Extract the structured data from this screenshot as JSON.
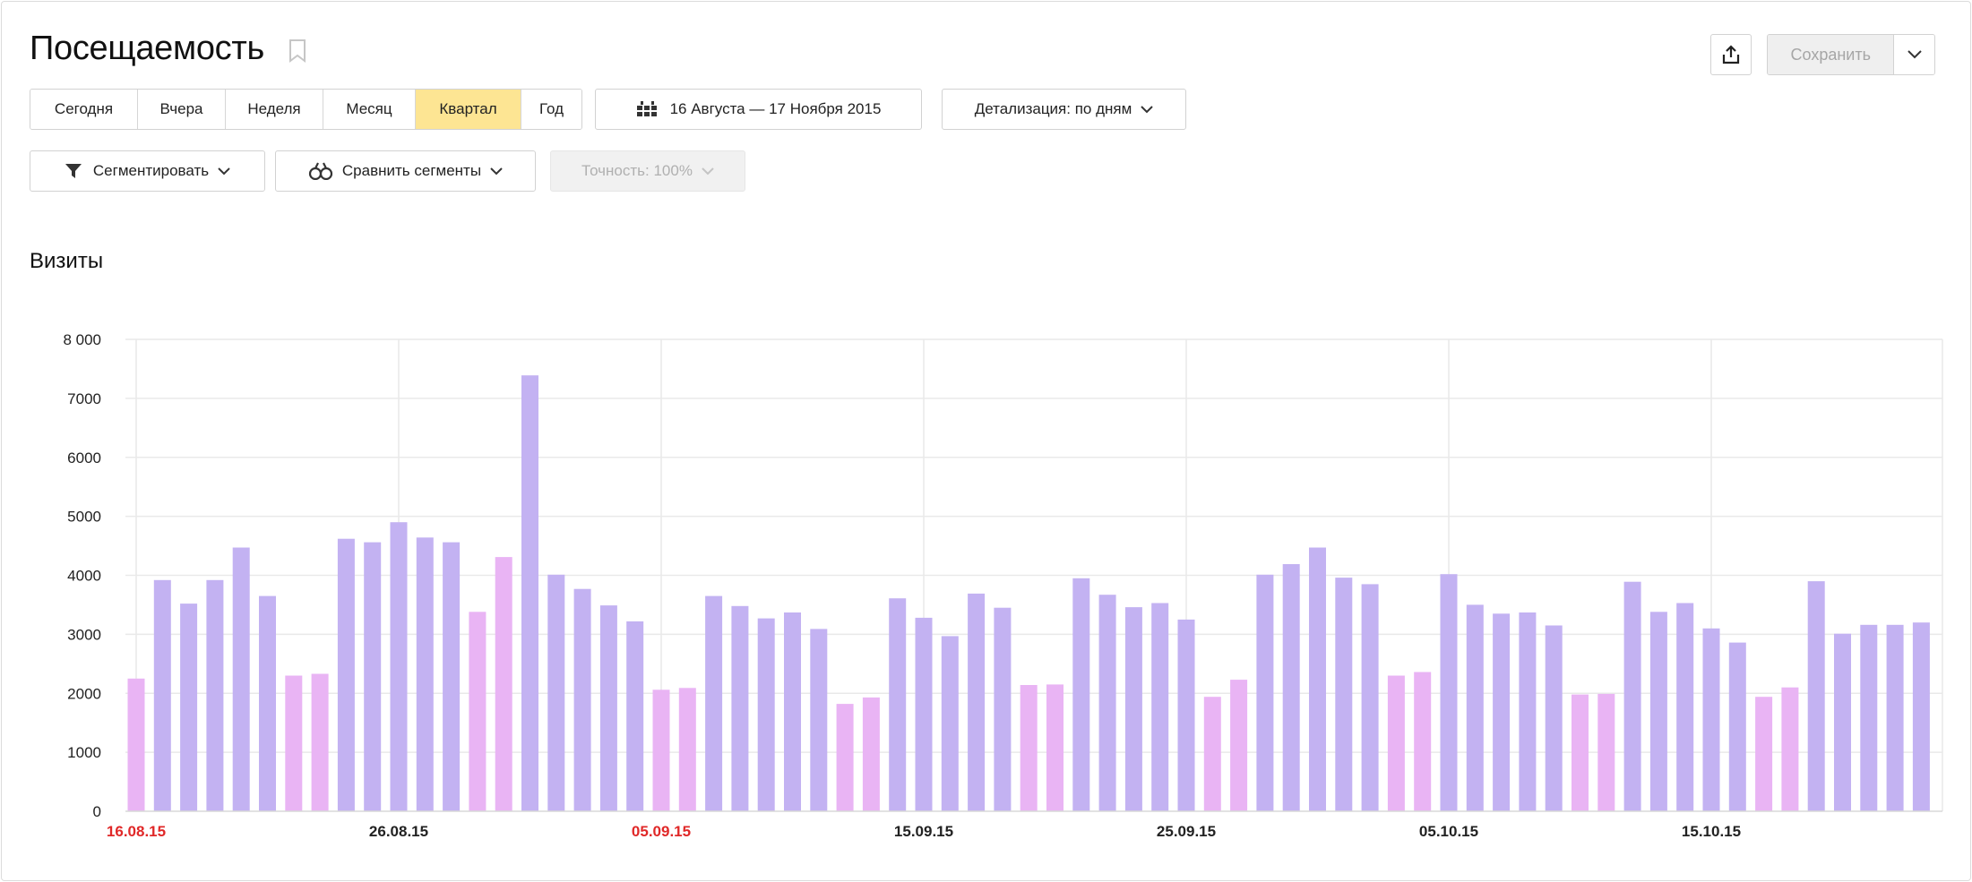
{
  "header": {
    "title": "Посещаемость",
    "share_icon": "share-icon",
    "save_label": "Сохранить",
    "bookmark_icon": "bookmark-icon"
  },
  "toolbar": {
    "periods": [
      {
        "label": "Сегодня",
        "active": false
      },
      {
        "label": "Вчера",
        "active": false
      },
      {
        "label": "Неделя",
        "active": false
      },
      {
        "label": "Месяц",
        "active": false
      },
      {
        "label": "Квартал",
        "active": true
      },
      {
        "label": "Год",
        "active": false
      }
    ],
    "date_range_label": "16 Августа — 17 Ноября 2015",
    "detail_label": "Детализация: по дням",
    "segment_label": "Сегментировать",
    "compare_label": "Сравнить сегменты",
    "accuracy_label": "Точность: 100%"
  },
  "colors": {
    "active_period": "#fde593",
    "bar_weekday": "#c3b2f2",
    "bar_weekend": "#e9b4f4",
    "weekend_tick": "#e02828",
    "grid": "#e9e9e9"
  },
  "chart_data": {
    "type": "bar",
    "title": "Визиты",
    "xlabel": "",
    "ylabel": "",
    "ylim": [
      0,
      8000
    ],
    "y_ticks": [
      0,
      1000,
      2000,
      3000,
      4000,
      5000,
      6000,
      7000,
      8000
    ],
    "y_tick_labels": [
      "0",
      "1000",
      "2000",
      "3000",
      "4000",
      "5000",
      "6000",
      "7000",
      "8 000"
    ],
    "x_tick_labels": [
      {
        "label": "16.08.15",
        "index": 0,
        "weekend": true
      },
      {
        "label": "26.08.15",
        "index": 10,
        "weekend": false
      },
      {
        "label": "05.09.15",
        "index": 20,
        "weekend": true
      },
      {
        "label": "15.09.15",
        "index": 30,
        "weekend": false
      },
      {
        "label": "25.09.15",
        "index": 40,
        "weekend": false
      },
      {
        "label": "05.10.15",
        "index": 50,
        "weekend": false
      },
      {
        "label": "15.10.15",
        "index": 60,
        "weekend": false
      }
    ],
    "grid": true,
    "series": [
      {
        "values": [
          2250,
          3920,
          3520,
          3920,
          4470,
          3650,
          2300,
          2330,
          4620,
          4560,
          4900,
          4640,
          4560,
          3380,
          4310,
          7390,
          4010,
          3770,
          3490,
          3220,
          2060,
          2090,
          3650,
          3480,
          3270,
          3370,
          3090,
          1820,
          1930,
          3610,
          3280,
          2970,
          3690,
          3450,
          2140,
          2150,
          3950,
          3670,
          3460,
          3530,
          3250,
          1940,
          2230,
          4010,
          4190,
          4470,
          3960,
          3850,
          2300,
          2360,
          4020,
          3500,
          3350,
          3370,
          3150,
          1980,
          1990,
          3890,
          3380,
          3530,
          3100,
          2860,
          1940,
          2100,
          3900,
          3010,
          3160,
          3160,
          3200
        ],
        "weekend": [
          1,
          0,
          0,
          0,
          0,
          0,
          1,
          1,
          0,
          0,
          0,
          0,
          0,
          1,
          1,
          0,
          0,
          0,
          0,
          0,
          1,
          1,
          0,
          0,
          0,
          0,
          0,
          1,
          1,
          0,
          0,
          0,
          0,
          0,
          1,
          1,
          0,
          0,
          0,
          0,
          0,
          1,
          1,
          0,
          0,
          0,
          0,
          0,
          1,
          1,
          0,
          0,
          0,
          0,
          0,
          1,
          1,
          0,
          0,
          0,
          0,
          0,
          1,
          1,
          0,
          0,
          0,
          0,
          0
        ]
      }
    ]
  }
}
